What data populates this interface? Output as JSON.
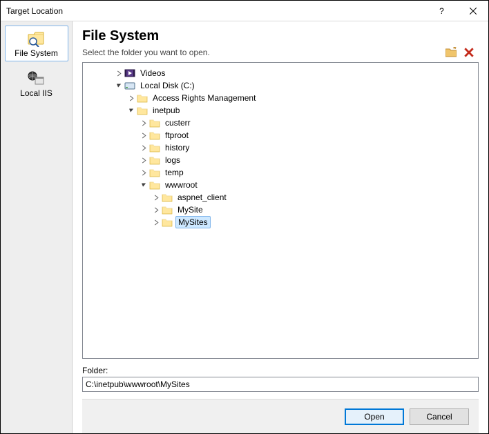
{
  "window": {
    "title": "Target Location"
  },
  "sidebar": {
    "items": [
      {
        "id": "filesystem",
        "label": "File System",
        "selected": true
      },
      {
        "id": "localiis",
        "label": "Local IIS",
        "selected": false
      }
    ]
  },
  "content": {
    "heading": "File System",
    "subhead": "Select the folder you want to open.",
    "folder_label": "Folder:",
    "folder_value": "C:\\inetpub\\wwwroot\\MySites"
  },
  "tree": [
    {
      "depth": 2,
      "exp": "closed",
      "icon": "videos",
      "label": "Videos"
    },
    {
      "depth": 2,
      "exp": "open",
      "icon": "disk",
      "label": "Local Disk (C:)"
    },
    {
      "depth": 3,
      "exp": "closed",
      "icon": "folder",
      "label": "Access Rights Management"
    },
    {
      "depth": 3,
      "exp": "open",
      "icon": "folder",
      "label": "inetpub"
    },
    {
      "depth": 4,
      "exp": "closed",
      "icon": "folder",
      "label": "custerr"
    },
    {
      "depth": 4,
      "exp": "closed",
      "icon": "folder",
      "label": "ftproot"
    },
    {
      "depth": 4,
      "exp": "closed",
      "icon": "folder",
      "label": "history"
    },
    {
      "depth": 4,
      "exp": "closed",
      "icon": "folder",
      "label": "logs"
    },
    {
      "depth": 4,
      "exp": "closed",
      "icon": "folder",
      "label": "temp"
    },
    {
      "depth": 4,
      "exp": "open",
      "icon": "folder",
      "label": "wwwroot"
    },
    {
      "depth": 5,
      "exp": "closed",
      "icon": "folder",
      "label": "aspnet_client"
    },
    {
      "depth": 5,
      "exp": "closed",
      "icon": "folder",
      "label": "MySite"
    },
    {
      "depth": 5,
      "exp": "closed",
      "icon": "folder",
      "label": "MySites",
      "selected": true
    }
  ],
  "buttons": {
    "open": "Open",
    "cancel": "Cancel"
  }
}
